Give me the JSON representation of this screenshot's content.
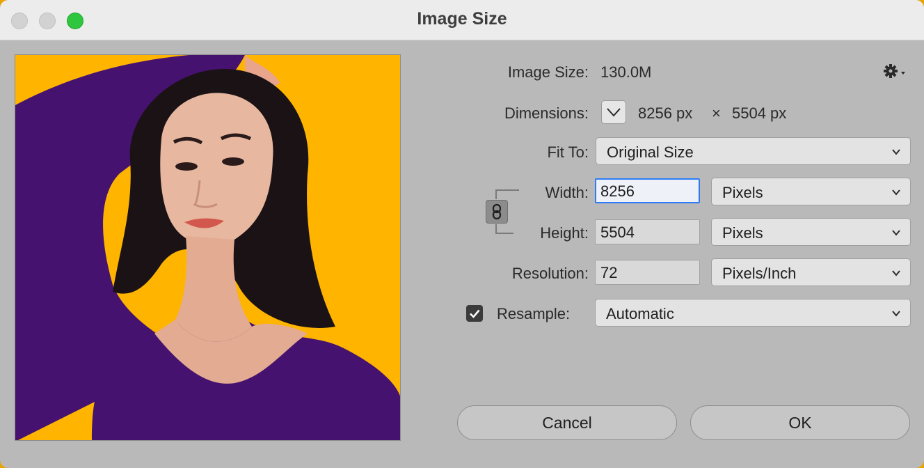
{
  "window": {
    "title": "Image Size"
  },
  "info": {
    "image_size_label": "Image Size:",
    "image_size_value": "130.0M",
    "dimensions_label": "Dimensions:",
    "dimensions_width": "8256 px",
    "dimensions_times": "×",
    "dimensions_height": "5504 px"
  },
  "fit_to": {
    "label": "Fit To:",
    "value": "Original Size"
  },
  "width": {
    "label": "Width:",
    "value": "8256",
    "unit": "Pixels"
  },
  "height": {
    "label": "Height:",
    "value": "5504",
    "unit": "Pixels"
  },
  "resolution": {
    "label": "Resolution:",
    "value": "72",
    "unit": "Pixels/Inch"
  },
  "resample": {
    "label": "Resample:",
    "checked": true,
    "value": "Automatic"
  },
  "buttons": {
    "cancel": "Cancel",
    "ok": "OK"
  },
  "colors": {
    "preview_background": "#ffb400",
    "shirt": "#45126f",
    "accent": "#2d7cf6",
    "zoom_button": "#2ec63f"
  },
  "icons": {
    "settings": "gear-icon",
    "dimensions_toggle": "chevron-down-icon",
    "constrain": "chain-link-icon",
    "resample_checkbox": "checkmark-icon"
  }
}
